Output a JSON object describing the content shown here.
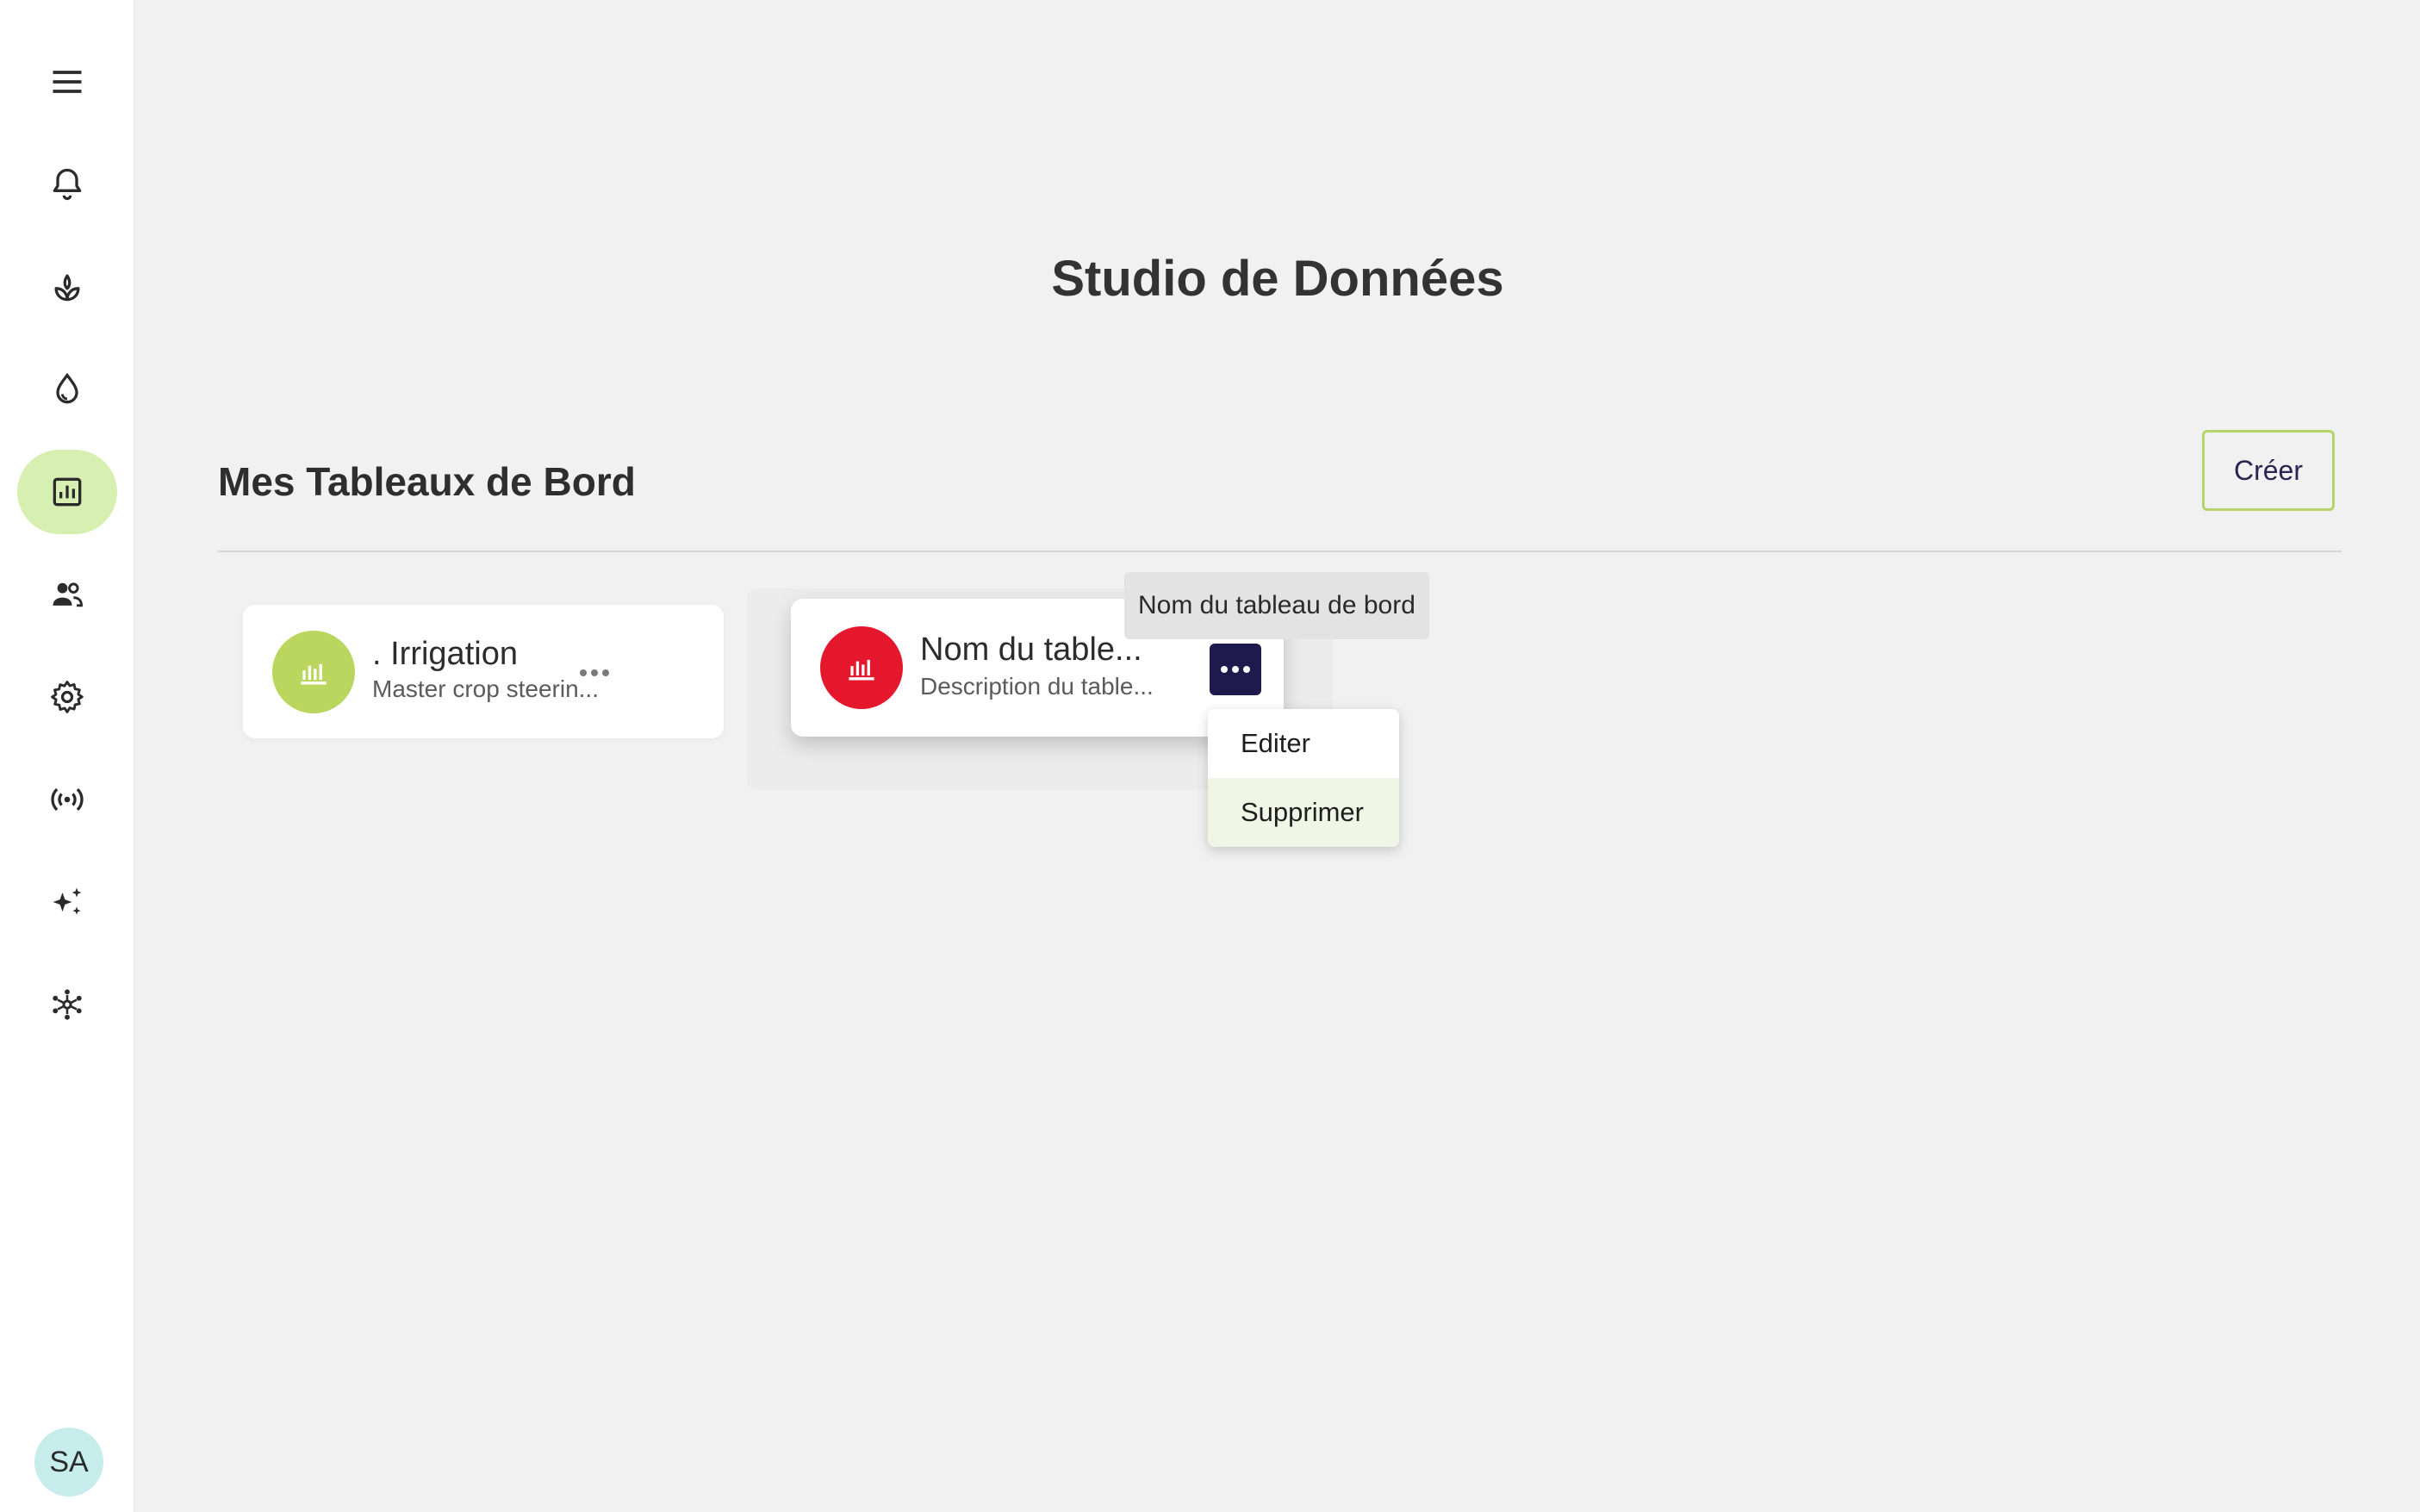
{
  "sidebar": {
    "items": [
      {
        "icon": "menu-icon"
      },
      {
        "icon": "bell-icon"
      },
      {
        "icon": "plant-icon"
      },
      {
        "icon": "water-drop-icon"
      },
      {
        "icon": "dashboard-chart-icon",
        "active": true
      },
      {
        "icon": "users-icon"
      },
      {
        "icon": "gear-icon"
      },
      {
        "icon": "broadcast-icon"
      },
      {
        "icon": "sparkles-icon"
      },
      {
        "icon": "network-icon"
      }
    ],
    "avatar_initials": "SA",
    "active_color": "#d7efb0"
  },
  "header": {
    "title": "Studio de Données"
  },
  "dashboards": {
    "section_title": "Mes Tableaux de Bord",
    "create_label": "Créer",
    "cards": [
      {
        "title": ". Irrigation",
        "subtitle": "Master crop steerin...",
        "icon_color": "#b9d65f",
        "icon": "bar-chart-icon"
      },
      {
        "title": "Nom du table...",
        "subtitle": "Description du table...",
        "icon_color": "#e5172d",
        "icon": "bar-chart-icon"
      }
    ]
  },
  "tooltip": {
    "text": "Nom du tableau de bord"
  },
  "context_menu": {
    "items": [
      {
        "label": "Editer"
      },
      {
        "label": "Supprimer",
        "hovered": true
      }
    ]
  },
  "colors": {
    "accent_green": "#b5d46a",
    "primary_dark": "#1f1a4d",
    "danger_red": "#e5172d"
  }
}
